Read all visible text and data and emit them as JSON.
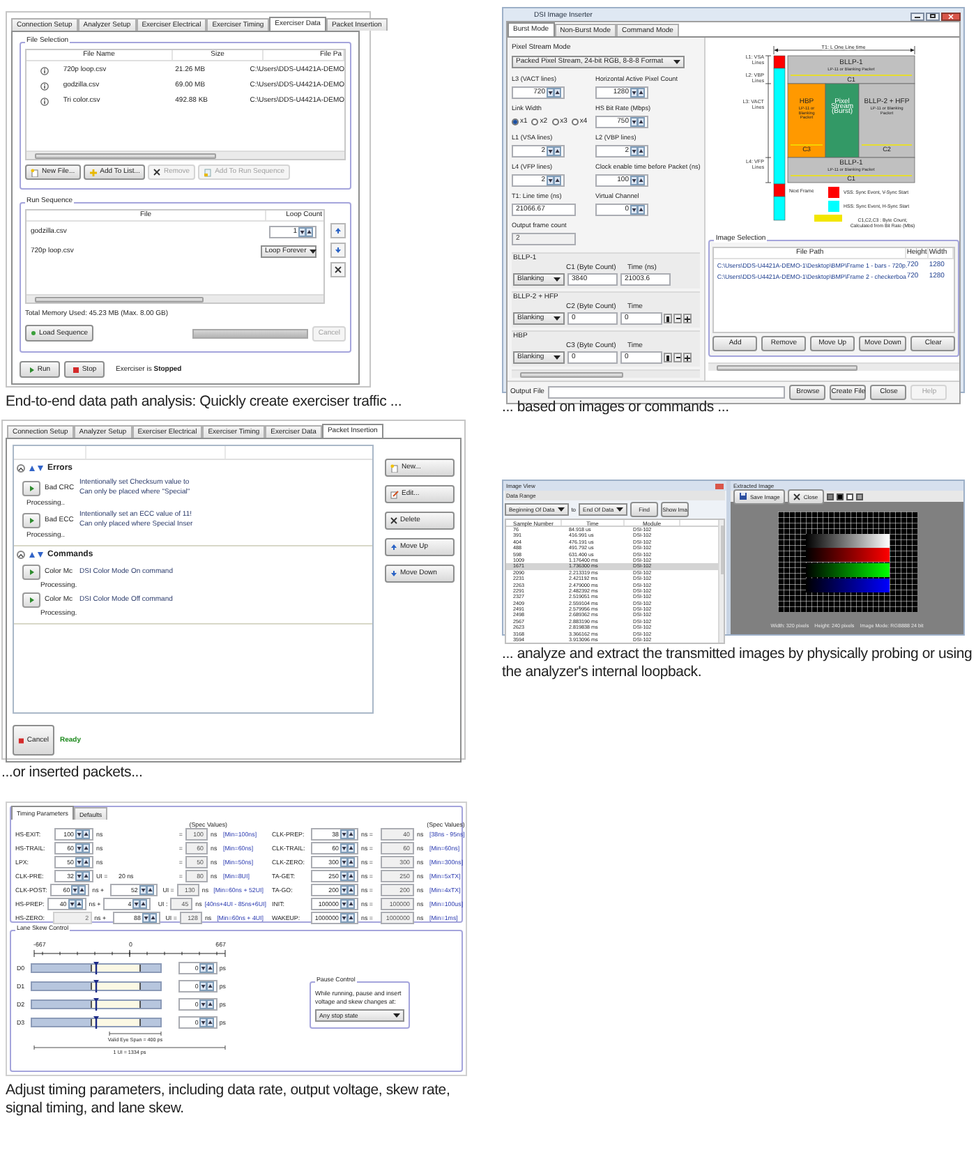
{
  "exerciser_data": {
    "tabs": [
      {
        "label": "Connection Setup",
        "selected": false
      },
      {
        "label": "Analyzer Setup",
        "selected": false
      },
      {
        "label": "Exerciser Electrical",
        "selected": false
      },
      {
        "label": "Exerciser Timing",
        "selected": false
      },
      {
        "label": "Exerciser Data",
        "selected": true
      },
      {
        "label": "Packet Insertion",
        "selected": false
      }
    ],
    "file_selection": {
      "title": "File Selection",
      "columns": [
        "File Name",
        "Size",
        "File Pa"
      ],
      "rows": [
        [
          "720p loop.csv",
          "21.26 MB",
          "C:\\Users\\DDS-U4421A-DEMO"
        ],
        [
          "godzilla.csv",
          "69.00 MB",
          "C:\\Users\\DDS-U4421A-DEMO"
        ],
        [
          "Tri color.csv",
          "492.88 KB",
          "C:\\Users\\DDS-U4421A-DEMO"
        ]
      ],
      "buttons": [
        {
          "label": "New File...",
          "disabled": false
        },
        {
          "label": "Add To List...",
          "disabled": false
        },
        {
          "label": "Remove",
          "disabled": true
        },
        {
          "label": "Add To Run Sequence",
          "disabled": true
        }
      ]
    },
    "run_sequence": {
      "title": "Run Sequence",
      "columns": [
        "File",
        "Loop Count"
      ],
      "rows": [
        {
          "file": "godzilla.csv",
          "kind": "spinner",
          "value": "1"
        },
        {
          "file": "720p loop.csv",
          "kind": "dropdown",
          "value": "Loop Forever"
        }
      ],
      "memory": "Total Memory Used: 45.23 MB (Max. 8.00 GB)",
      "load_button": "Load Sequence",
      "progress": {
        "level": 1
      },
      "cancel_button": {
        "label": "Cancel",
        "disabled": true
      }
    },
    "run_button": "Run",
    "stop_button": "Stop",
    "status": "Exerciser is **Stopped**",
    "caption": "End-to-end data path analysis: Quickly create exerciser traffic ..."
  },
  "image_inserter": {
    "title": "DSI Image Inserter",
    "tabs": [
      {
        "label": "Burst Mode",
        "selected": true
      },
      {
        "label": "Non-Burst Mode",
        "selected": false
      },
      {
        "label": "Command Mode",
        "selected": false
      }
    ],
    "pixel_stream_mode": {
      "label": "Pixel Stream Mode",
      "value": "Packed Pixel Stream, 24-bit RGB, 8-8-8 Format"
    },
    "fields": [
      {
        "label": "L3 (VACT lines)",
        "kind": "spinner",
        "value": "720"
      },
      {
        "label": "Horizontal Active Pixel Count",
        "kind": "spinner",
        "value": "1280"
      },
      {
        "label": "Link Width",
        "kind": "radios",
        "options": [
          {
            "label": "x1",
            "selected": true
          },
          {
            "label": "x2",
            "selected": false
          },
          {
            "label": "x3",
            "selected": false
          },
          {
            "label": "x4",
            "selected": false
          }
        ]
      },
      {
        "label": "HS Bit Rate (Mbps)",
        "kind": "spinner",
        "value": "750"
      },
      {
        "label": "L1 (VSA lines)",
        "kind": "spinner",
        "value": "2"
      },
      {
        "label": "L2 (VBP lines)",
        "kind": "spinner",
        "value": "2"
      },
      {
        "label": "L4 (VFP lines)",
        "kind": "spinner",
        "value": "2"
      },
      {
        "label": "Clock enable time before Packet (ns)",
        "kind": "spinner",
        "value": "100"
      },
      {
        "label": "T1: Line time (ns)",
        "kind": "text",
        "value": "21066.67"
      },
      {
        "label": "Virtual Channel",
        "kind": "spinner",
        "value": "0"
      },
      {
        "label": "Output frame count",
        "kind": "readonly",
        "value": "2"
      }
    ],
    "blanking": [
      {
        "title": "BLLP-1",
        "mode": "Blanking",
        "count_label": "C1 (Byte Count)",
        "count": "3840",
        "time_label": "Time (ns)",
        "time": "21003.6",
        "kind": "text"
      },
      {
        "title": "BLLP-2 + HFP",
        "mode": "Blanking",
        "count_label": "C2 (Byte Count)",
        "count": "0",
        "time_label": "Time",
        "time": "0",
        "kind": "stepper"
      },
      {
        "title": "HBP",
        "mode": "Blanking",
        "count_label": "C3 (Byte Count)",
        "count": "0",
        "time_label": "Time",
        "time": "0",
        "kind": "stepper"
      }
    ],
    "diagram": {
      "line_time": "T1: L One Line time",
      "rows": [
        {
          "lines": [
            "L1: VSA",
            "Lines"
          ]
        },
        {
          "lines": [
            "L2: VBP",
            "Lines"
          ]
        },
        {
          "lines": [
            "L3: VACT",
            "Lines"
          ]
        },
        {
          "lines": [
            "L4: VFP",
            "Lines"
          ]
        }
      ],
      "blocks": [
        {
          "lines": [
            "BLLP-1",
            "LP-11 or Blanking Packet"
          ],
          "count": "C1",
          "color": "#c0c0c0"
        },
        {
          "lines": [
            "HBP",
            "LP-11 or",
            "Blanking",
            "Packet"
          ],
          "count": "C3",
          "color": "#ff9900"
        },
        {
          "lines": [
            "Pixel",
            "Stream",
            "(Burst)"
          ],
          "color": "#339966"
        },
        {
          "lines": [
            "BLLP-2 + HFP",
            "LP-11 or Blanking",
            "Packet"
          ],
          "count": "C2",
          "color": "#c0c0c0"
        },
        {
          "lines": [
            "BLLP-1",
            "LP-11 or Blanking Packet"
          ],
          "count": "C1",
          "color": "#c0c0c0"
        }
      ],
      "next_frame": "Next Frame",
      "legend": [
        {
          "lines": [
            "VSS: Sync Event, V-Sync Start"
          ],
          "color": "#ff0000"
        },
        {
          "lines": [
            "HSS: Sync Event, H-Sync Start"
          ],
          "color": "#00ffff"
        },
        {
          "lines": [
            "C1,C2,C3 : Byte Count;",
            "Calculated from Bit Rate (Mbs)"
          ],
          "color": "#f2e600"
        }
      ]
    },
    "image_selection": {
      "title": "Image Selection",
      "columns": [
        "File Path",
        "Height",
        "Width"
      ],
      "rows": [
        [
          "C:\\Users\\DDS-U4421A-DEMO-1\\Desktop\\BMP\\Frame 1 - bars - 720p.",
          "720",
          "1280"
        ],
        [
          "C:\\Users\\DDS-U4421A-DEMO-1\\Desktop\\BMP\\Frame 2 - checkerboa",
          "720",
          "1280"
        ]
      ],
      "buttons": [
        "Add",
        "Remove",
        "Move Up",
        "Move Down",
        "Clear"
      ]
    },
    "output_label": "Output File",
    "bottom_buttons": [
      {
        "label": "Browse",
        "disabled": false
      },
      {
        "label": "Create File",
        "disabled": false
      },
      {
        "label": "Close",
        "disabled": false
      },
      {
        "label": "Help",
        "disabled": true
      }
    ],
    "caption": "... based on images or commands ..."
  },
  "packet_insertion": {
    "tabs": [
      {
        "label": "Connection Setup",
        "selected": false
      },
      {
        "label": "Analyzer Setup",
        "selected": false
      },
      {
        "label": "Exerciser Electrical",
        "selected": false
      },
      {
        "label": "Exerciser Timing",
        "selected": false
      },
      {
        "label": "Exerciser Data",
        "selected": false
      },
      {
        "label": "Packet Insertion",
        "selected": true
      }
    ],
    "groups": [
      {
        "title": "Errors",
        "expanded": true,
        "items": [
          {
            "name": "Bad CRC",
            "lines": [
              "Intentionally set Checksum value to",
              "Can only be placed where \"Special\""
            ],
            "status": "Processing.."
          },
          {
            "name": "Bad ECC",
            "lines": [
              "Intentionally set an ECC value of 11!",
              "Can only placed where Special Inser"
            ],
            "status": "Processing.."
          }
        ]
      },
      {
        "title": "Commands",
        "expanded": true,
        "items": [
          {
            "name": "Color Mc",
            "lines": [
              "DSI Color Mode On command"
            ],
            "status": "Processing."
          },
          {
            "name": "Color Mc",
            "lines": [
              "DSI Color Mode Off command"
            ],
            "status": "Processing."
          }
        ]
      }
    ],
    "buttons": [
      "New...",
      "Edit...",
      "Delete",
      "Move Up",
      "Move Down"
    ],
    "cancel": "Cancel",
    "status": "Ready",
    "caption": "...or inserted packets..."
  },
  "image_view": {
    "title": "Image View",
    "toolbar_title": "Data Range",
    "from": "Beginning Of Data",
    "to": "to",
    "until": "End Of Data",
    "find": "Find",
    "show": "Show Ima",
    "columns": [
      "Sample Number",
      "Time",
      "Module"
    ],
    "rows": [
      {
        "cells": [
          "76",
          "84.918 us",
          "DSI-102"
        ],
        "selected": false
      },
      {
        "cells": [
          "391",
          "416.991 us",
          "DSI-102"
        ],
        "selected": false
      },
      {
        "cells": [
          "404",
          "476.191 us",
          "DSI-102"
        ],
        "selected": false
      },
      {
        "cells": [
          "488",
          "491.792 us",
          "DSI-102"
        ],
        "selected": false
      },
      {
        "cells": [
          "598",
          "631.400 us",
          "DSI-102"
        ],
        "selected": false
      },
      {
        "cells": [
          "1009",
          "1.176400 ms",
          "DSI-102"
        ],
        "selected": false
      },
      {
        "cells": [
          "1671",
          "1.736300 ms",
          "DSI-102"
        ],
        "selected": true
      },
      {
        "cells": [
          "2090",
          "2.213319 ms",
          "DSI-102"
        ],
        "selected": false
      },
      {
        "cells": [
          "2231",
          "2.421192 ms",
          "DSI-102"
        ],
        "selected": false
      },
      {
        "cells": [
          "2263",
          "2.479000 ms",
          "DSI-102"
        ],
        "selected": false
      },
      {
        "cells": [
          "2291",
          "2.482392 ms",
          "DSI-102"
        ],
        "selected": false
      },
      {
        "cells": [
          "2327",
          "2.519051 ms",
          "DSI-102"
        ],
        "selected": false
      },
      {
        "cells": [
          "2409",
          "2.559104 ms",
          "DSI-102"
        ],
        "selected": false
      },
      {
        "cells": [
          "2491",
          "2.579956 ms",
          "DSI-102"
        ],
        "selected": false
      },
      {
        "cells": [
          "2498",
          "2.689362 ms",
          "DSI-102"
        ],
        "selected": false
      },
      {
        "cells": [
          "2567",
          "2.883190 ms",
          "DSI-102"
        ],
        "selected": false
      },
      {
        "cells": [
          "2623",
          "2.819838 ms",
          "DSI-102"
        ],
        "selected": false
      },
      {
        "cells": [
          "3168",
          "3.366162 ms",
          "DSI-102"
        ],
        "selected": false
      },
      {
        "cells": [
          "3594",
          "3.913096 ms",
          "DSI-102"
        ],
        "selected": false
      }
    ],
    "extracted_title": "Extracted Image",
    "save": "Save Image",
    "close": "Close",
    "swatches": [
      {
        "color": "#808080"
      },
      {
        "color": "#000000"
      },
      {
        "color": "#ffffff"
      },
      {
        "color": "#a0a0a0"
      }
    ],
    "info": [
      "Width: 320 pixels",
      "Height: 240 pixels",
      "Image Mode: RGB888 24 bit"
    ],
    "caption": "... analyze and extract the transmitted  images by physically probing or using the analyzer's internal loopback."
  },
  "timing": {
    "tabs": [
      {
        "label": "Timing Parameters",
        "selected": true
      },
      {
        "label": "Defaults",
        "selected": false
      }
    ],
    "spec_headers": [
      "(Spec Values)",
      "(Spec Values)"
    ],
    "left": [
      {
        "name": "HS-EXIT:",
        "value": "100",
        "unit": "ns",
        "op": "=",
        "result": "100",
        "result_unit": "ns",
        "spec": "[Min=100ns]",
        "disabled": false
      },
      {
        "name": "HS-TRAIL:",
        "value": "60",
        "unit": "ns",
        "op": "=",
        "result": "60",
        "result_unit": "ns",
        "spec": "[Min=60ns]",
        "disabled": false
      },
      {
        "name": "LPX:",
        "value": "50",
        "unit": "ns",
        "op": "=",
        "result": "50",
        "result_unit": "ns",
        "spec": "[Min=50ns]",
        "disabled": false
      },
      {
        "name": "CLK-PRE:",
        "value": "32",
        "unit": "UI =",
        "mid": {
          "kind": "text",
          "value": "20 ns"
        },
        "op": "=",
        "result": "80",
        "result_unit": "ns",
        "spec": "[Min=8UI]",
        "disabled": false
      },
      {
        "name": "CLK-POST:",
        "value": "60",
        "unit": "ns +",
        "mid": {
          "kind": "spinner",
          "value": "52"
        },
        "op": "UI =",
        "result": "130",
        "result_unit": "ns",
        "spec": "[Min=60ns + 52UI]",
        "disabled": false
      },
      {
        "name": "HS-PREP:",
        "value": "40",
        "unit": "ns +",
        "mid": {
          "kind": "spinner",
          "value": "4"
        },
        "op": "UI :",
        "result": "45",
        "result_unit": "ns",
        "spec": "[40ns+4UI - 85ns+6UI]",
        "disabled": false
      },
      {
        "name": "HS-ZERO:",
        "value": "2",
        "unit": "ns +",
        "mid": {
          "kind": "spinner",
          "value": "88"
        },
        "op": "UI =",
        "result": "128",
        "result_unit": "ns",
        "spec": "[Min=60ns + 4UI]",
        "disabled": true
      }
    ],
    "right": [
      {
        "name": "CLK-PREP:",
        "value": "38",
        "unit": "ns =",
        "result": "40",
        "result_unit": "ns",
        "spec": "[38ns - 95ns]"
      },
      {
        "name": "CLK-TRAIL:",
        "value": "60",
        "unit": "ns =",
        "result": "60",
        "result_unit": "ns",
        "spec": "[Min=60ns]"
      },
      {
        "name": "CLK-ZERO:",
        "value": "300",
        "unit": "ns =",
        "result": "300",
        "result_unit": "ns",
        "spec": "[Min=300ns]"
      },
      {
        "name": "TA-GET:",
        "value": "250",
        "unit": "ns =",
        "result": "250",
        "result_unit": "ns",
        "spec": "[Min=5xTX]"
      },
      {
        "name": "TA-GO:",
        "value": "200",
        "unit": "ns =",
        "result": "200",
        "result_unit": "ns",
        "spec": "[Min=4xTX]"
      },
      {
        "name": "INIT:",
        "value": "100000",
        "unit": "ns =",
        "result": "100000",
        "result_unit": "ns",
        "spec": "[Min=100us]"
      },
      {
        "name": "WAKEUP:",
        "value": "1000000",
        "unit": "ns =",
        "result": "1000000",
        "result_unit": "ns",
        "spec": "[Min=1ms]"
      }
    ],
    "skew_title": "Lane Skew Control",
    "axis": [
      "-667",
      "0",
      "667"
    ],
    "lanes": [
      {
        "name": "D0",
        "level": 0.5,
        "value": "0",
        "unit": "ps"
      },
      {
        "name": "D1",
        "level": 0.5,
        "value": "0",
        "unit": "ps"
      },
      {
        "name": "D2",
        "level": 0.5,
        "value": "0",
        "unit": "ps"
      },
      {
        "name": "D3",
        "level": 0.5,
        "value": "0",
        "unit": "ps"
      }
    ],
    "eye_span": "Valid Eye Span = 400 ps",
    "ui_span": "1 UI = 1334 ps",
    "pause": {
      "title": "Pause Control",
      "text": "While running, pause and insert voltage and skew changes at:",
      "value": "Any stop state"
    },
    "caption": "Adjust timing parameters, including data rate, output voltage, skew rate, signal timing, and lane skew."
  }
}
